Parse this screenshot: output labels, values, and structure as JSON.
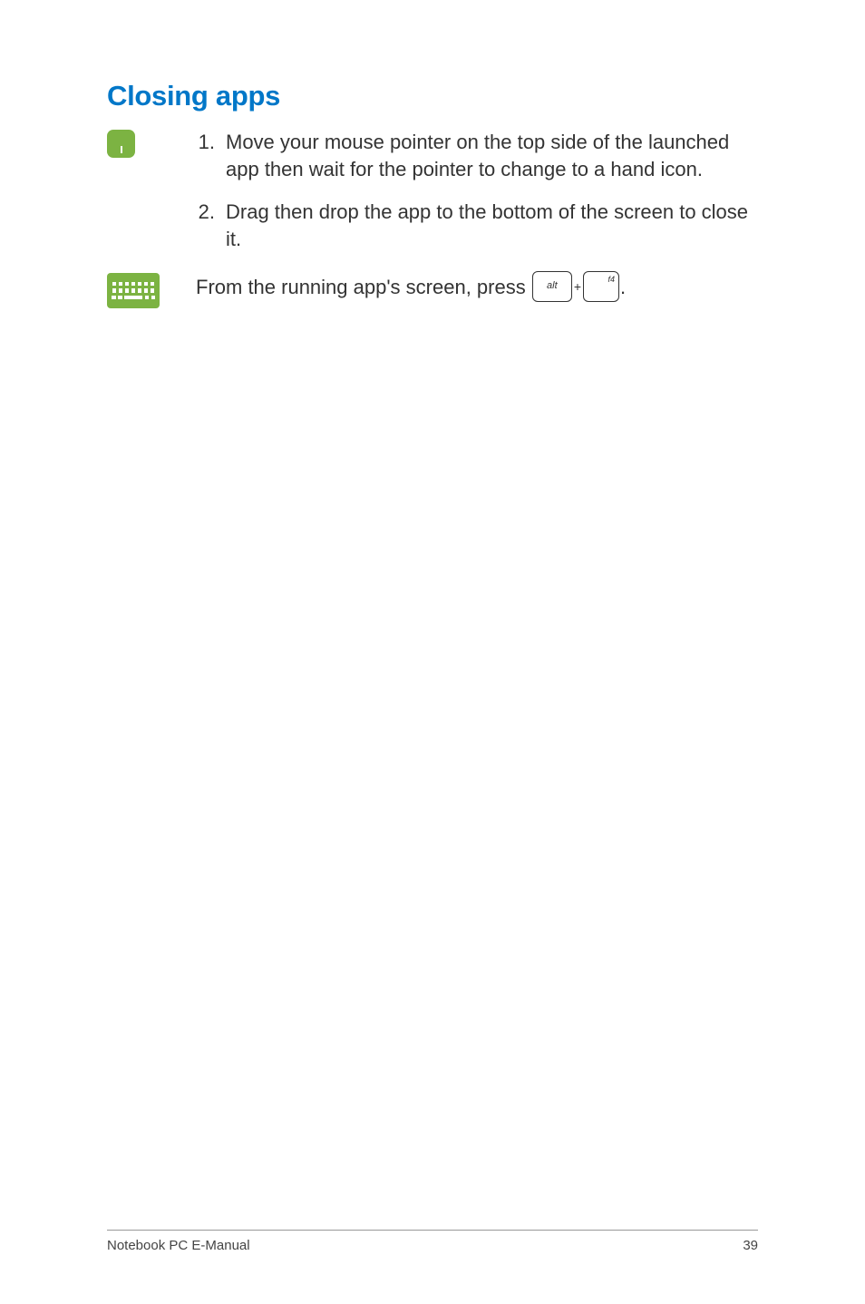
{
  "heading": "Closing apps",
  "mouse_instructions": {
    "item1": {
      "num": "1.",
      "text": "Move your mouse pointer on the top side of the launched app then wait for the pointer to change to a hand icon."
    },
    "item2": {
      "num": "2.",
      "text": "Drag then drop the app to the bottom of the screen to close it."
    }
  },
  "keyboard_instruction": {
    "prefix": "From the running app's screen, press ",
    "key1": "alt",
    "plus": "+",
    "key2": "f4",
    "suffix": "."
  },
  "footer": {
    "left": "Notebook PC E-Manual",
    "right": "39"
  }
}
